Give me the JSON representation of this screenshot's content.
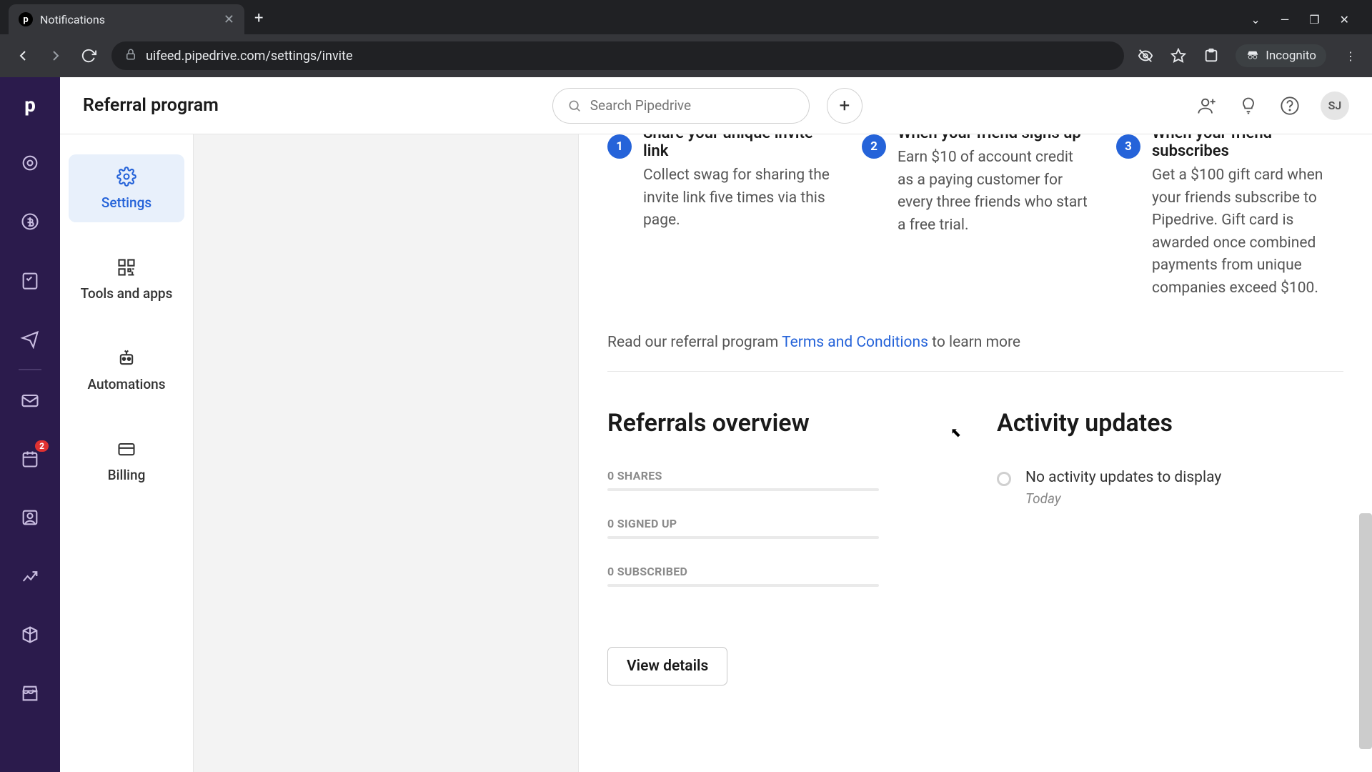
{
  "browser": {
    "tab_title": "Notifications",
    "url": "uifeed.pipedrive.com/settings/invite",
    "incognito_label": "Incognito"
  },
  "header": {
    "title": "Referral program",
    "search_placeholder": "Search Pipedrive",
    "avatar_initials": "SJ"
  },
  "rail": {
    "badge_count": "2"
  },
  "sidebar": {
    "items": [
      {
        "label": "Settings"
      },
      {
        "label": "Tools and apps"
      },
      {
        "label": "Automations"
      },
      {
        "label": "Billing"
      }
    ]
  },
  "steps": [
    {
      "num": "1",
      "title": "Share your unique invite link",
      "desc": "Collect swag for sharing the invite link five times via this page."
    },
    {
      "num": "2",
      "title": "When your friend signs up",
      "desc": "Earn $10 of account credit as a paying customer for every three friends who start a free trial."
    },
    {
      "num": "3",
      "title": "When your friend subscribes",
      "desc": "Get a $100 gift card when your friends subscribe to Pipedrive. Gift card is awarded once combined payments from unique companies exceed $100."
    }
  ],
  "terms": {
    "pre": "Read our referral program ",
    "link": "Terms and Conditions",
    "post": " to learn more"
  },
  "overview": {
    "heading": "Referrals overview",
    "stats": [
      {
        "label": "0 SHARES"
      },
      {
        "label": "0 SIGNED UP"
      },
      {
        "label": "0 SUBSCRIBED"
      }
    ],
    "view_details": "View details"
  },
  "activity": {
    "heading": "Activity updates",
    "empty_text": "No activity updates to display",
    "empty_sub": "Today"
  }
}
